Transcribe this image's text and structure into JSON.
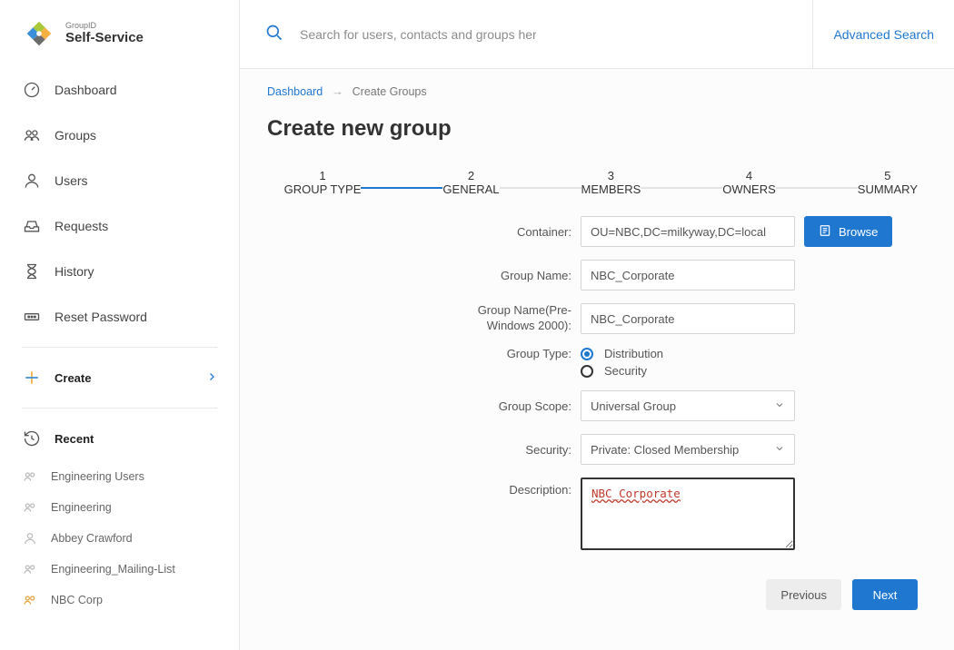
{
  "app": {
    "brand_small": "GroupID",
    "brand": "Self-Service"
  },
  "sidebar": {
    "items": [
      {
        "label": "Dashboard"
      },
      {
        "label": "Groups"
      },
      {
        "label": "Users"
      },
      {
        "label": "Requests"
      },
      {
        "label": "History"
      },
      {
        "label": "Reset Password"
      }
    ],
    "create_label": "Create",
    "recent_label": "Recent",
    "recent": [
      {
        "label": "Engineering Users"
      },
      {
        "label": "Engineering"
      },
      {
        "label": "Abbey Crawford"
      },
      {
        "label": "Engineering_Mailing-List"
      },
      {
        "label": "NBC Corp"
      }
    ]
  },
  "topbar": {
    "search_placeholder": "Search for users, contacts and groups here.",
    "advanced": "Advanced Search"
  },
  "breadcrumb": {
    "root": "Dashboard",
    "current": "Create Groups"
  },
  "page": {
    "title": "Create new group"
  },
  "stepper": {
    "steps": [
      {
        "num": "1",
        "label": "GROUP TYPE"
      },
      {
        "num": "2",
        "label": "GENERAL"
      },
      {
        "num": "3",
        "label": "MEMBERS"
      },
      {
        "num": "4",
        "label": "OWNERS"
      },
      {
        "num": "5",
        "label": "SUMMARY"
      }
    ]
  },
  "form": {
    "container_label": "Container:",
    "container_value": "OU=NBC,DC=milkyway,DC=local",
    "browse_label": "Browse",
    "group_name_label": "Group Name:",
    "group_name_value": "NBC_Corporate",
    "group_name_pre_label_l1": "Group Name(Pre-",
    "group_name_pre_label_l2": "Windows 2000):",
    "group_name_pre_value": "NBC_Corporate",
    "group_type_label": "Group Type:",
    "group_type_options": {
      "distribution": "Distribution",
      "security": "Security"
    },
    "group_scope_label": "Group Scope:",
    "group_scope_value": "Universal Group",
    "security_label": "Security:",
    "security_value": "Private: Closed Membership",
    "description_label": "Description:",
    "description_value": "NBC_Corporate"
  },
  "footer": {
    "previous": "Previous",
    "next": "Next"
  }
}
